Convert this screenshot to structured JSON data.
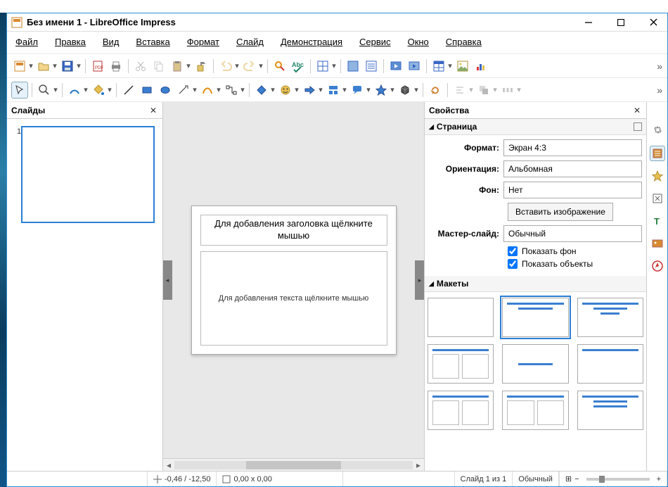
{
  "titlebar": {
    "title": "Без имени 1 - LibreOffice Impress"
  },
  "menu": {
    "file": "Файл",
    "edit": "Правка",
    "view": "Вид",
    "insert": "Вставка",
    "format": "Формат",
    "slide": "Слайд",
    "show": "Демонстрация",
    "tools": "Сервис",
    "window": "Окно",
    "help": "Справка"
  },
  "panes": {
    "slides_title": "Слайды",
    "properties_title": "Свойства",
    "page_section": "Страница",
    "layouts_section": "Макеты"
  },
  "slide": {
    "number": "1",
    "title_placeholder": "Для добавления заголовка щёлкните мышью",
    "body_placeholder": "Для добавления текста щёлкните мышью"
  },
  "properties": {
    "format_label": "Формат:",
    "format_value": "Экран 4:3",
    "orientation_label": "Ориентация:",
    "orientation_value": "Альбомная",
    "background_label": "Фон:",
    "background_value": "Нет",
    "insert_image": "Вставить изображение",
    "master_label": "Мастер-слайд:",
    "master_value": "Обычный",
    "show_background": "Показать фон",
    "show_objects": "Показать объекты",
    "show_background_checked": true,
    "show_objects_checked": true
  },
  "status": {
    "coords": "-0,46 / -12,50",
    "size": "0,00 x 0,00",
    "slide_count": "Слайд 1 из 1",
    "master": "Обычный",
    "zoom_fit_icon": "⊞"
  },
  "colors": {
    "accent": "#2a7fd4"
  }
}
